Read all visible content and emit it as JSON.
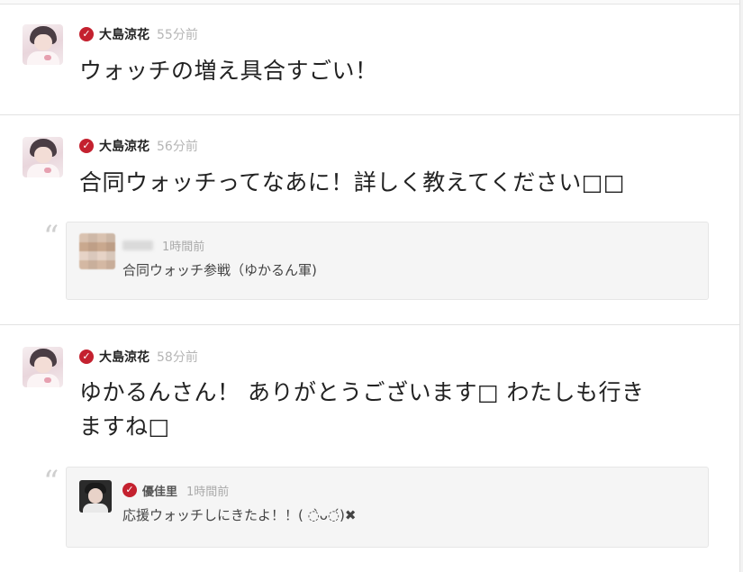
{
  "posts": [
    {
      "author": "大島涼花",
      "time": "55分前",
      "text": "ウォッチの増え具合すごい！"
    },
    {
      "author": "大島涼花",
      "time": "56分前",
      "text": "合同ウォッチってなあに！詳しく教えてください□□",
      "reply": {
        "author": "",
        "time": "1時間前",
        "text": "合同ウォッチ参戦（ゆかるん軍)"
      }
    },
    {
      "author": "大島涼花",
      "time": "58分前",
      "text_line1": "ゆかるんさん！ ありがとうございます□ わたしも行き",
      "text_line2": "ますね□",
      "reply": {
        "author": "優佳里",
        "time": "1時間前",
        "text": "応援ウォッチしにきたよ！！( ◌̀ᴗ◌́)✖"
      }
    }
  ],
  "icons": {
    "verified": "verified-check-icon",
    "quote": "quote-icon"
  },
  "colors": {
    "verified_badge": "#c4212f",
    "timestamp": "#b5b5b5",
    "reply_bg": "#f5f5f5"
  }
}
